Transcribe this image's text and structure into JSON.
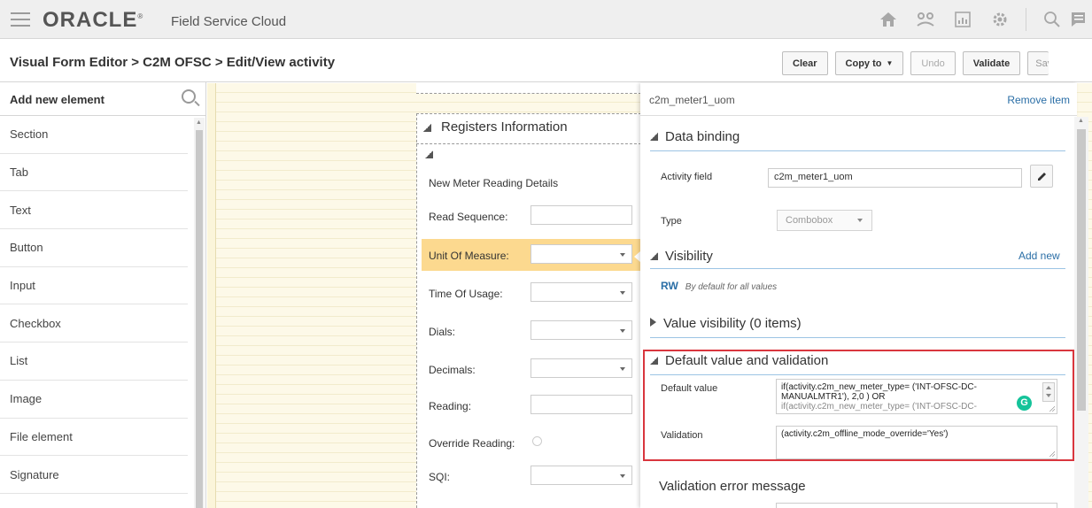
{
  "header": {
    "brand": "ORACLE",
    "product": "Field Service Cloud",
    "icons": [
      "home-icon",
      "routing-icon",
      "dashboard-icon",
      "settings-icon",
      "search-icon",
      "chat-icon"
    ]
  },
  "titlebar": {
    "breadcrumb": "Visual Form Editor > C2M OFSC > Edit/View activity",
    "buttons": {
      "clear": "Clear",
      "copy_to": "Copy to",
      "undo": "Undo",
      "validate": "Validate",
      "save_partial": "Sav"
    }
  },
  "palette": {
    "header": "Add new element",
    "items": [
      "Section",
      "Tab",
      "Text",
      "Button",
      "Input",
      "Checkbox",
      "List",
      "Image",
      "File element",
      "Signature"
    ]
  },
  "form": {
    "section_title": "Registers Information",
    "subsection_label": "New Meter Reading Details",
    "fields": [
      {
        "label": "Read Sequence:",
        "kind": "input"
      },
      {
        "label": "Unit Of Measure:",
        "kind": "dropdown",
        "selected": true
      },
      {
        "label": "Time Of Usage:",
        "kind": "dropdown"
      },
      {
        "label": "Dials:",
        "kind": "dropdown"
      },
      {
        "label": "Decimals:",
        "kind": "dropdown"
      },
      {
        "label": "Reading:",
        "kind": "input"
      },
      {
        "label": "Override Reading:",
        "kind": "radio"
      },
      {
        "label": "SQI:",
        "kind": "dropdown"
      }
    ]
  },
  "properties": {
    "item_name": "c2m_meter1_uom",
    "remove_item": "Remove item",
    "data_binding": {
      "title": "Data binding",
      "activity_field_label": "Activity field",
      "activity_field_value": "c2m_meter1_uom",
      "type_label": "Type",
      "type_value": "Combobox"
    },
    "visibility": {
      "title": "Visibility",
      "add_new": "Add new",
      "rw": "RW",
      "rw_note": "By default for all values"
    },
    "value_visibility": {
      "title": "Value visibility",
      "count": "(0 items)"
    },
    "default_validation": {
      "title": "Default value and validation",
      "default_value_label": "Default value",
      "default_value_lines": [
        "if(activity.c2m_new_meter_type= ('INT-OFSC-DC-",
        "MANUALMTR1'), 2,0 ) OR",
        "if(activity.c2m_new_meter_type= ('INT-OFSC-DC-"
      ],
      "validation_label": "Validation",
      "validation_value": "(activity.c2m_offline_mode_override='Yes')"
    },
    "validation_error": {
      "title": "Validation error message"
    }
  },
  "colors": {
    "accent_link": "#2a6ea6",
    "selected_row": "#fcd98f",
    "highlight_border": "#d9363e",
    "canvas": "#fdf9e8"
  }
}
